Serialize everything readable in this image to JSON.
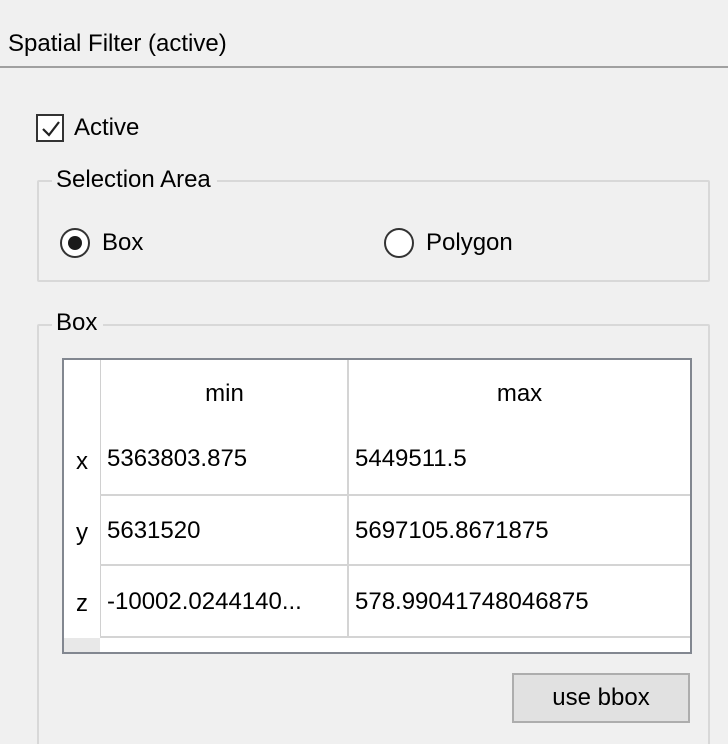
{
  "panel": {
    "title": "Spatial Filter (active)"
  },
  "active_checkbox": {
    "label": "Active",
    "checked": true
  },
  "selection_area": {
    "title": "Selection Area",
    "options": [
      {
        "label": "Box",
        "selected": true
      },
      {
        "label": "Polygon",
        "selected": false
      }
    ]
  },
  "box": {
    "title": "Box",
    "columns": [
      "min",
      "max"
    ],
    "rows": [
      {
        "label": "x",
        "min": "5363803.875",
        "max": "5449511.5"
      },
      {
        "label": "y",
        "min": "5631520",
        "max": "5697105.8671875"
      },
      {
        "label": "z",
        "min": "-10002.0244140...",
        "max": "578.99041748046875"
      }
    ]
  },
  "buttons": {
    "use_bbox": "use bbox"
  }
}
